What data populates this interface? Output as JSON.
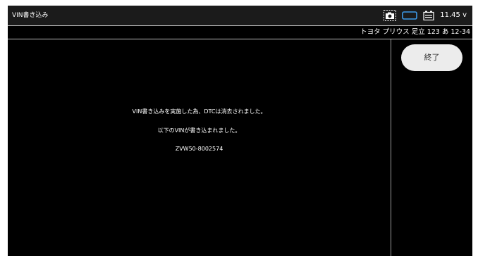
{
  "header": {
    "title": "VIN書き込み",
    "icons": [
      "camera-icon",
      "connection-icon",
      "battery-icon"
    ],
    "voltage": "11.45 v"
  },
  "vehicle": {
    "info": "トヨタ プリウス 足立 123 あ 12-34"
  },
  "main": {
    "message_line1": "VIN書き込みを実施した為、DTCは消去されました。",
    "message_line2": "以下のVINが書き込まれました。",
    "vin": "ZVW50-8002574"
  },
  "side": {
    "end_label": "終了"
  },
  "colors": {
    "background": "#000000",
    "titlebar": "#1b1b1b",
    "text": "#ffffff",
    "button_bg": "#ececec",
    "connection_icon": "#3d9be9"
  }
}
